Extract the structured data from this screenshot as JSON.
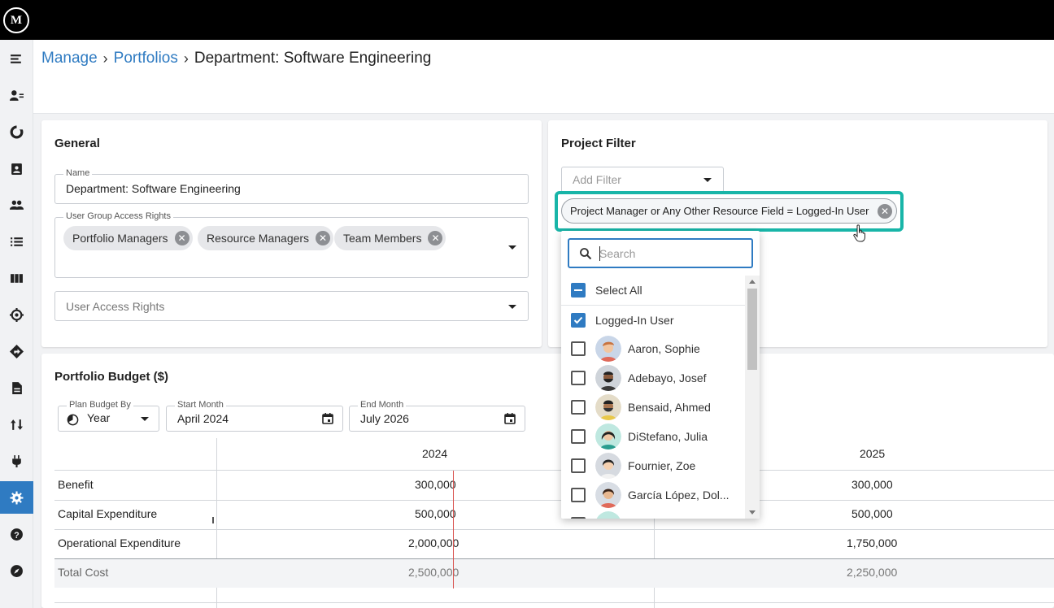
{
  "logo": {
    "text": "M"
  },
  "sidebar": {
    "items": [
      {
        "name": "menu-icon"
      },
      {
        "name": "resources-icon"
      },
      {
        "name": "dashboard-icon"
      },
      {
        "name": "assignments-icon"
      },
      {
        "name": "people-icon"
      },
      {
        "name": "list-icon"
      },
      {
        "name": "columns-icon"
      },
      {
        "name": "target-icon"
      },
      {
        "name": "directions-icon"
      },
      {
        "name": "document-icon"
      },
      {
        "name": "sort-icon"
      },
      {
        "name": "plug-icon"
      },
      {
        "name": "gear-icon",
        "active": true
      },
      {
        "name": "help-icon"
      },
      {
        "name": "compass-icon"
      }
    ]
  },
  "breadcrumb": {
    "manage": "Manage",
    "portfolios": "Portfolios",
    "current": "Department: Software Engineering",
    "separator": "›"
  },
  "general": {
    "title": "General",
    "name_label": "Name",
    "name_value": "Department: Software Engineering",
    "group_rights_label": "User Group Access Rights",
    "group_chips": [
      "Portfolio Managers",
      "Resource Managers",
      "Team Members"
    ],
    "user_rights_placeholder": "User Access Rights"
  },
  "project_filter": {
    "title": "Project Filter",
    "add_filter_placeholder": "Add Filter",
    "active_filter": "Project Manager or Any Other Resource Field = Logged-In User"
  },
  "dropdown": {
    "search_placeholder": "Search",
    "select_all": "Select All",
    "options": [
      {
        "label": "Logged-In User",
        "checked": true,
        "avatar": false
      },
      {
        "label": "Aaron, Sophie",
        "checked": false,
        "avatar": true
      },
      {
        "label": "Adebayo, Josef",
        "checked": false,
        "avatar": true
      },
      {
        "label": "Bensaid, Ahmed",
        "checked": false,
        "avatar": true
      },
      {
        "label": "DiStefano, Julia",
        "checked": false,
        "avatar": true
      },
      {
        "label": "Fournier, Zoe",
        "checked": false,
        "avatar": true
      },
      {
        "label": "García López, Dol...",
        "checked": false,
        "avatar": true
      }
    ]
  },
  "budget": {
    "title": "Portfolio Budget ($)",
    "plan_by_label": "Plan Budget By",
    "plan_by_value": "Year",
    "start_label": "Start Month",
    "start_value": "April 2024",
    "end_label": "End Month",
    "end_value": "July 2026",
    "years": [
      "2024",
      "2025"
    ],
    "rows": [
      {
        "label": "Benefit",
        "y2024": "300,000",
        "y2025": "300,000"
      },
      {
        "label": "Capital Expenditure",
        "y2024": "500,000",
        "y2025": "500,000"
      },
      {
        "label": "Operational Expenditure",
        "y2024": "2,000,000",
        "y2025": "1,750,000"
      },
      {
        "label": "Total Cost",
        "y2024": "2,500,000",
        "y2025": "2,250,000"
      }
    ]
  },
  "colors": {
    "accent": "#2f7bc2",
    "highlight": "#18b5a8",
    "today_line": "#d9534f"
  }
}
